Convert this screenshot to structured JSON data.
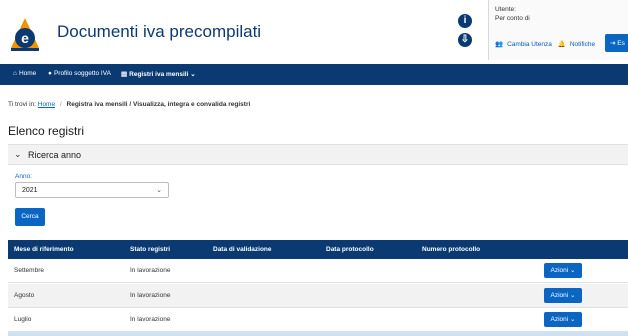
{
  "header": {
    "title": "Documenti iva precompilati",
    "logo_icon": "agenzia-entrate-logo",
    "icons": [
      "info-icon",
      "download-icon"
    ]
  },
  "user": {
    "utente_label": "Utente:",
    "per_conto_label": "Per conto di",
    "change_user": "Cambia Utenza",
    "notifications": "Notifiche",
    "exit": "Es"
  },
  "nav": {
    "home": "Home",
    "profilo": "Profilo soggetto IVA",
    "registri": "Registri iva mensili"
  },
  "breadcrumb": {
    "prefix": "Ti trovi in:",
    "home": "Home",
    "current": "Registra iva mensili / Visualizza, integra e convalida registri"
  },
  "page_title": "Elenco registri",
  "search": {
    "title": "Ricerca anno",
    "anno_label": "Anno:",
    "anno_value": "2021",
    "cerca": "Cerca"
  },
  "table": {
    "columns": [
      "Mese di riferimento",
      "Stato registri",
      "Data di validazione",
      "Data protocollo",
      "Numero protocollo"
    ],
    "rows": [
      {
        "mese": "Settembre",
        "stato": "In lavorazione",
        "azioni": "Azioni"
      },
      {
        "mese": "Agosto",
        "stato": "In lavorazione",
        "azioni": "Azioni"
      },
      {
        "mese": "Luglio",
        "stato": "In lavorazione",
        "azioni": "Azioni"
      }
    ]
  },
  "colors": {
    "primary_dark": "#0b3a73",
    "primary": "#0b66c3"
  }
}
